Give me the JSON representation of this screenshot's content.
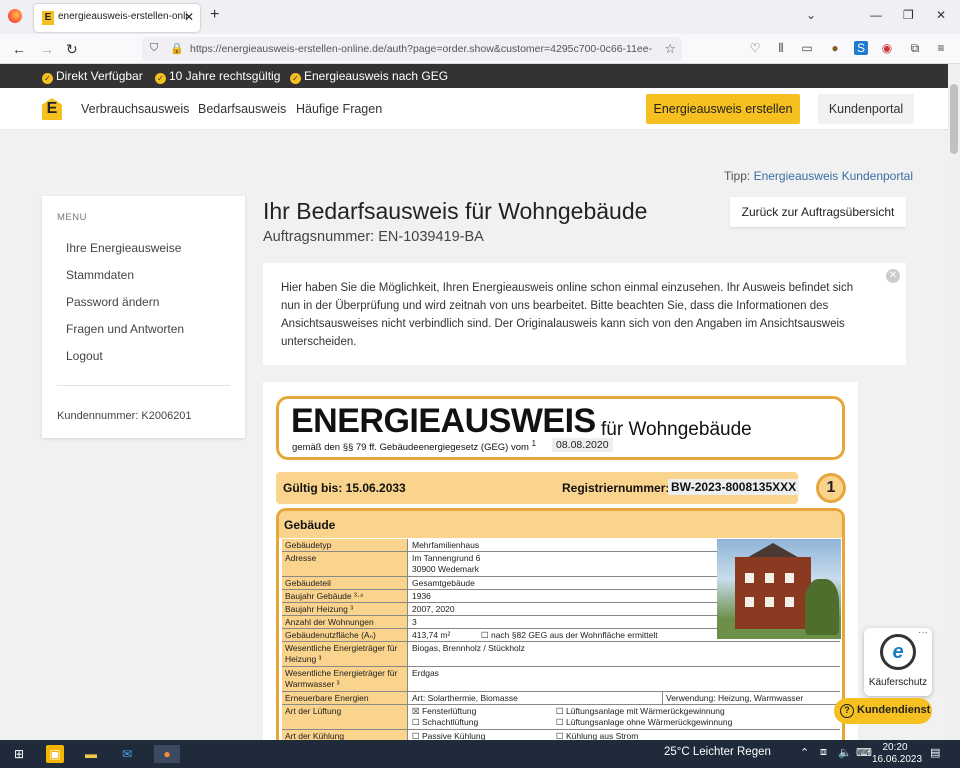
{
  "browser": {
    "tab_title": "energieausweis-erstellen-online",
    "tab_close": "✕",
    "new_tab": "+",
    "url": "https://energieausweis-erstellen-online.de/auth?page=order.show&customer=4295c700-0c66-11ee-",
    "window_controls": {
      "minimize": "—",
      "maximize": "❐",
      "close": "✕",
      "dropdown": "⌄"
    },
    "nav": {
      "back": "←",
      "forward": "→",
      "reload": "↻"
    }
  },
  "promo": {
    "items": [
      "Direkt Verfügbar",
      "10 Jahre rechtsgültig",
      "Energieausweis nach GEG"
    ]
  },
  "site_nav": {
    "logo_letter": "E",
    "links": [
      "Verbrauchsausweis",
      "Bedarfsausweis",
      "Häufige Fragen"
    ],
    "create_button": "Energieausweis erstellen",
    "portal_button": "Kundenportal"
  },
  "tip": {
    "prefix": "Tipp:",
    "link": "Energieausweis Kundenportal"
  },
  "sidebar": {
    "heading": "MENU",
    "items": [
      "Ihre Energieausweise",
      "Stammdaten",
      "Password ändern",
      "Fragen und Antworten",
      "Logout"
    ],
    "customer_number": "Kundennummer: K2006201"
  },
  "main": {
    "title": "Ihr Bedarfsausweis für Wohngebäude",
    "order_number": "Auftragsnummer: EN-1039419-BA",
    "back_button": "Zurück zur Auftragsübersicht",
    "notice": "Hier haben Sie die Möglichkeit, Ihren Energieausweis online schon einmal einzusehen. Ihr Ausweis befindet sich nun in der Überprüfung und wird zeitnah von uns bearbeitet. Bitte beachten Sie, dass die Informationen des Ansichtsausweises nicht verbindlich sind. Der Originalausweis kann sich von den Angaben im Ansichtsausweis unterscheiden."
  },
  "certificate": {
    "heading": "ENERGIEAUSWEIS",
    "subheading": "für Wohngebäude",
    "law": "gemäß den §§ 79 ff. Gebäudeenergiegesetz (GEG) vom",
    "law_sup": "1",
    "law_date": "08.08.2020",
    "valid_until": "Gültig bis: 15.06.2033",
    "registration_label": "Registriernummer:",
    "registration_number": "BW-2023-8008135XXX",
    "page_number": "1",
    "section_title": "Gebäude",
    "rows": [
      {
        "label": "Gebäudetyp",
        "value": "Mehrfamilienhaus"
      },
      {
        "label": "Adresse",
        "value": "Im Tannengrund 6",
        "value2": "30900 Wedemark"
      },
      {
        "label": "Gebäudeteil",
        "value": "Gesamtgebäude"
      },
      {
        "label": "Baujahr Gebäude ³·⁴",
        "value": "1936"
      },
      {
        "label": "Baujahr Heizung ³",
        "value": "2007, 2020"
      },
      {
        "label": "Anzahl der Wohnungen",
        "value": "3"
      },
      {
        "label": "Gebäudenutzfläche (Aₙ)",
        "value": "413,74 m²",
        "extra": "☐ nach §82 GEG aus der Wohnfläche ermittelt"
      },
      {
        "label": "Wesentliche Energieträger für Heizung ³",
        "value": "Biogas, Brennholz / Stückholz"
      },
      {
        "label": "Wesentliche Energieträger für Warmwasser ³",
        "value": "Erdgas"
      },
      {
        "label": "Erneuerbare Energien",
        "value": "Art: Solarthermie, Biomasse",
        "extra": "Verwendung: Heizung, Warmwasser"
      },
      {
        "label": "Art der Lüftung",
        "value": "☒ Fensterlüftung",
        "value2": "☐ Schachtlüftung",
        "extra": "☐ Lüftungsanlage mit Wärmerückgewinnung",
        "extra2": "☐ Lüftungsanlage ohne Wärmerückgewinnung"
      },
      {
        "label": "Art der Kühlung",
        "value": "☐ Passive Kühlung",
        "extra": "☐ Kühlung aus Strom"
      }
    ]
  },
  "widgets": {
    "kaeuferschutz": "Käuferschutz",
    "kaeuferschutz_more": "···",
    "kundendienst": "Kundendienst"
  },
  "taskbar": {
    "weather": "25°C  Leichter Regen",
    "time": "20:20",
    "date": "16.06.2023"
  },
  "colors": {
    "accent": "#f5c020",
    "cert_orange": "#e8a53a",
    "cert_fill": "#fad38c",
    "dark_bar": "#333333"
  }
}
